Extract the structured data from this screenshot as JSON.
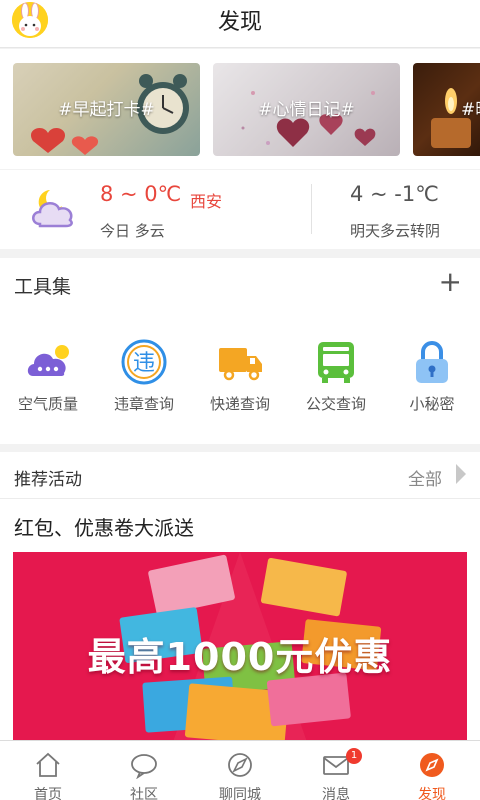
{
  "header": {
    "title": "发现",
    "avatar_icon": "bunny-avatar-icon"
  },
  "banners": [
    {
      "label": "#早起打卡#"
    },
    {
      "label": "#心情日记#"
    },
    {
      "label": "#晒"
    }
  ],
  "weather": {
    "today_temp": "8 ~ 0℃",
    "city": "西安",
    "today_desc": "今日 多云",
    "tomorrow_temp": "4 ~ -1℃",
    "tomorrow_desc": "明天多云转阴",
    "icon": "cloudy-moon-icon"
  },
  "tools": {
    "title": "工具集",
    "add_label": "+",
    "items": [
      {
        "label": "空气质量",
        "icon": "air-quality-icon",
        "color": "#7c5fd6"
      },
      {
        "label": "违章查询",
        "icon": "traffic-violation-icon",
        "color": "#2f8fe6"
      },
      {
        "label": "快递查询",
        "icon": "delivery-truck-icon",
        "color": "#f4a623"
      },
      {
        "label": "公交查询",
        "icon": "bus-icon",
        "color": "#5bbf3c"
      },
      {
        "label": "小秘密",
        "icon": "lock-icon",
        "color": "#3b8fe6"
      }
    ]
  },
  "activity": {
    "title": "推荐活动",
    "all_label": "全部",
    "headline": "红包、优惠卷大派送",
    "promo_text": "最高1000元优惠"
  },
  "tabbar": {
    "items": [
      {
        "label": "首页",
        "icon": "home-icon",
        "active": false
      },
      {
        "label": "社区",
        "icon": "chat-bubble-icon",
        "active": false
      },
      {
        "label": "聊同城",
        "icon": "city-compass-icon",
        "active": false
      },
      {
        "label": "消息",
        "icon": "mail-icon",
        "active": false,
        "badge": "1"
      },
      {
        "label": "发现",
        "icon": "discover-icon",
        "active": true
      }
    ],
    "active_color": "#f05a1e"
  }
}
